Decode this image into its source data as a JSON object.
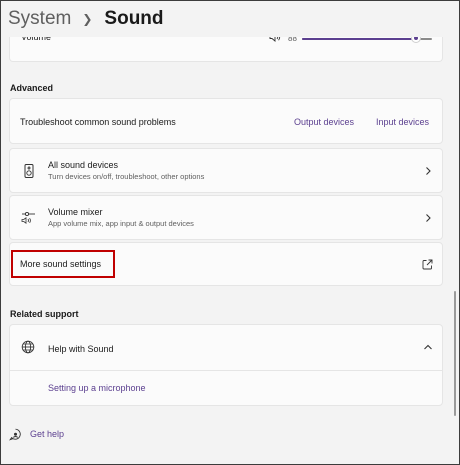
{
  "header": {
    "parent": "System",
    "current": "Sound"
  },
  "volume": {
    "label": "Volume",
    "value": "88",
    "level": 0.88
  },
  "advanced": {
    "title": "Advanced",
    "troubleshoot": {
      "label": "Troubleshoot common sound problems",
      "output_link": "Output devices",
      "input_link": "Input devices"
    },
    "all_devices": {
      "title": "All sound devices",
      "subtitle": "Turn devices on/off, troubleshoot, other options"
    },
    "volume_mixer": {
      "title": "Volume mixer",
      "subtitle": "App volume mix, app input & output devices"
    },
    "more_settings": {
      "label": "More sound settings"
    }
  },
  "related_support": {
    "title": "Related support",
    "help": {
      "label": "Help with Sound",
      "links": [
        "Setting up a microphone"
      ]
    }
  },
  "footer": {
    "get_help": "Get help"
  },
  "colors": {
    "accent": "#5b3f8f",
    "highlight": "#c00000"
  }
}
